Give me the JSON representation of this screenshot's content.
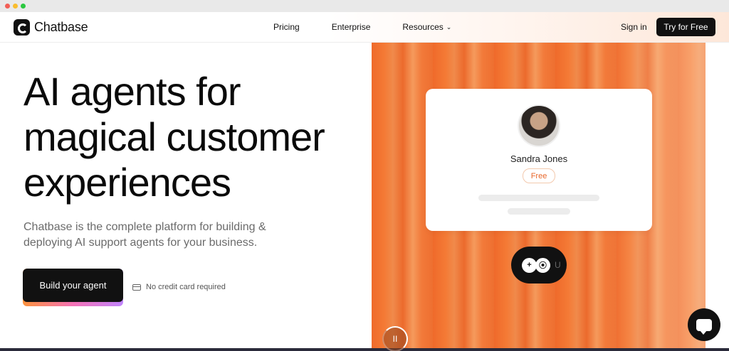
{
  "nav": {
    "brand": "Chatbase",
    "links": [
      {
        "label": "Pricing"
      },
      {
        "label": "Enterprise"
      },
      {
        "label": "Resources",
        "chevron": "⌄"
      }
    ],
    "sign_in": "Sign in",
    "cta": "Try for Free"
  },
  "hero": {
    "title_lines": [
      "AI agents for",
      "magical customer",
      "experiences"
    ],
    "subtitle": "Chatbase is the complete platform for building & deploying AI support agents for your business.",
    "primary_button": "Build your agent",
    "note": "No credit card required",
    "note_icon": "credit-card-icon"
  },
  "visual": {
    "card": {
      "name": "Sandra Jones",
      "badge": "Free"
    },
    "pill": {
      "icons": [
        "sparkle-plus-icon",
        "lock-icon"
      ],
      "glyphs": [
        "+",
        "⦿"
      ],
      "trailing": "U"
    },
    "pause_icon": "pause-icon",
    "pause_glyph": "II"
  },
  "chat_widget": {
    "icon": "chat-bubble-icon"
  },
  "colors": {
    "accent_orange": "#ef6a2b",
    "badge_text": "#e8672b",
    "button_dark": "#111111"
  }
}
